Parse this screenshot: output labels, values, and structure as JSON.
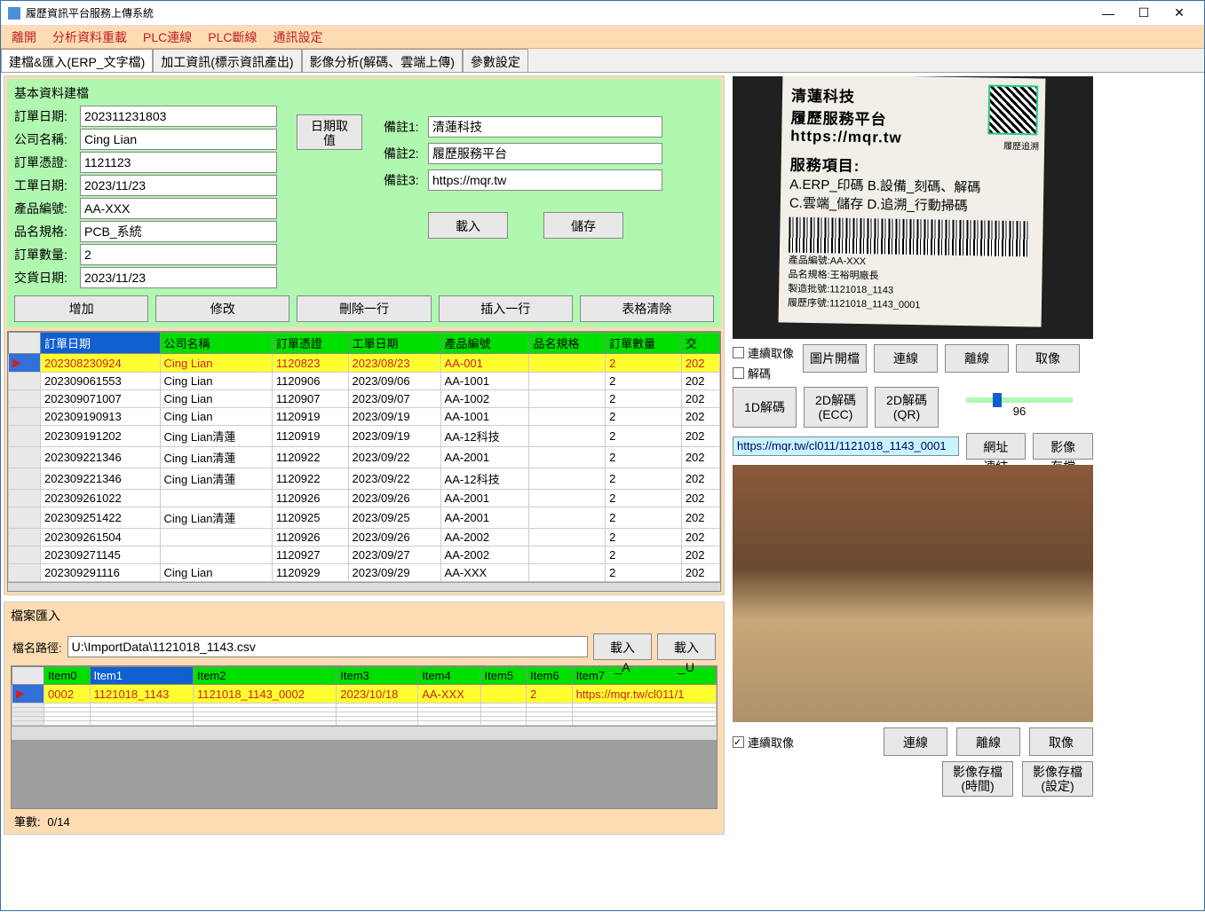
{
  "window": {
    "title": "履歷資訊平台服務上傳系統"
  },
  "menu": [
    "離開",
    "分析資料重載",
    "PLC連線",
    "PLC斷線",
    "通訊設定"
  ],
  "tabs": [
    "建檔&匯入(ERP_文字檔)",
    "加工資訊(標示資訊產出)",
    "影像分析(解碼、雲端上傳)",
    "參數設定"
  ],
  "basic": {
    "title": "基本資料建檔",
    "labels": {
      "order_date": "訂單日期:",
      "company": "公司名稱:",
      "voucher": "訂單憑證:",
      "work_date": "工單日期:",
      "prod_no": "產品編號:",
      "spec": "品名規格:",
      "qty": "訂單數量:",
      "deliver": "交貨日期:",
      "note1": "備註1:",
      "note2": "備註2:",
      "note3": "備註3:"
    },
    "values": {
      "order_date": "202311231803",
      "company": "Cing Lian",
      "voucher": "1121123",
      "work_date": "2023/11/23",
      "prod_no": "AA-XXX",
      "spec": "PCB_系統",
      "qty": "2",
      "deliver": "2023/11/23",
      "note1": "清蓮科技",
      "note2": "履歷服務平台",
      "note3": "https://mqr.tw"
    },
    "date_btn": "日期取值",
    "load_btn": "載入",
    "save_btn": "儲存",
    "row_btns": [
      "增加",
      "修改",
      "刪除一行",
      "插入一行",
      "表格清除"
    ]
  },
  "grid": {
    "headers": [
      "訂單日期",
      "公司名稱",
      "訂單憑證",
      "工單日期",
      "產品編號",
      "品名規格",
      "訂單數量",
      "交"
    ],
    "rows": [
      [
        "202308230924",
        "Cing Lian",
        "1120823",
        "2023/08/23",
        "AA-001",
        "",
        "2",
        "202"
      ],
      [
        "202309061553",
        "Cing Lian",
        "1120906",
        "2023/09/06",
        "AA-1001",
        "",
        "2",
        "202"
      ],
      [
        "202309071007",
        "Cing Lian",
        "1120907",
        "2023/09/07",
        "AA-1002",
        "",
        "2",
        "202"
      ],
      [
        "202309190913",
        "Cing Lian",
        "1120919",
        "2023/09/19",
        "AA-1001",
        "",
        "2",
        "202"
      ],
      [
        "202309191202",
        "Cing Lian清蓮",
        "1120919",
        "2023/09/19",
        "AA-12科技",
        "",
        "2",
        "202"
      ],
      [
        "202309221346",
        "Cing Lian清蓮",
        "1120922",
        "2023/09/22",
        "AA-2001",
        "",
        "2",
        "202"
      ],
      [
        "202309221346",
        "Cing Lian清蓮",
        "1120922",
        "2023/09/22",
        "AA-12科技",
        "",
        "2",
        "202"
      ],
      [
        "202309261022",
        "",
        "1120926",
        "2023/09/26",
        "AA-2001",
        "",
        "2",
        "202"
      ],
      [
        "202309251422",
        "Cing Lian清蓮",
        "1120925",
        "2023/09/25",
        "AA-2001",
        "",
        "2",
        "202"
      ],
      [
        "202309261504",
        "",
        "1120926",
        "2023/09/26",
        "AA-2002",
        "",
        "2",
        "202"
      ],
      [
        "202309271145",
        "",
        "1120927",
        "2023/09/27",
        "AA-2002",
        "",
        "2",
        "202"
      ],
      [
        "202309291116",
        "Cing Lian",
        "1120929",
        "2023/09/29",
        "AA-XXX",
        "",
        "2",
        "202"
      ]
    ]
  },
  "file_import": {
    "title": "檔案匯入",
    "path_label": "檔名路徑:",
    "path": "U:\\ImportData\\1121018_1143.csv",
    "btn_a": "載入_A",
    "btn_u": "載入_U",
    "headers": [
      "Item0",
      "Item1",
      "Item2",
      "Item3",
      "Item4",
      "Item5",
      "Item6",
      "Item7"
    ],
    "row": [
      "0002",
      "1121018_1143",
      "1121018_1143_0002",
      "2023/10/18",
      "AA-XXX",
      "",
      "2",
      "https://mqr.tw/cl011/1"
    ],
    "count_label": "筆數:",
    "count_value": "0/14"
  },
  "label_preview": {
    "l1": "清蓮科技",
    "l2": "履歷服務平台",
    "l3": "https://mqr.tw",
    "qr_caption": "履歷追溯",
    "l4": "服務項目:",
    "l5": "A.ERP_印碼  B.設備_刻碼、解碼",
    "l6": "C.雲端_儲存 D.追溯_行動掃碼",
    "s1": "產品編號:AA-XXX",
    "s2": "品名規格:王裕明廠長",
    "s3": "製造批號:1121018_1143",
    "s4": "履歷序號:1121018_1143_0001"
  },
  "right": {
    "chk_cont": "連續取像",
    "chk_decode": "解碼",
    "btns1": [
      "圖片開檔",
      "連線",
      "離線",
      "取像"
    ],
    "btns2": [
      "1D解碼",
      "2D解碼\n(ECC)",
      "2D解碼\n(QR)"
    ],
    "slider_val": "96",
    "decode_result": "https://mqr.tw/cl011/1121018_1143_0001",
    "link_btn": "網址連結",
    "img_save": "影像存檔",
    "chk_cont2": "連續取像",
    "btns3": [
      "連線",
      "離線",
      "取像"
    ],
    "btns4": [
      "影像存檔\n(時間)",
      "影像存檔\n(設定)"
    ]
  }
}
